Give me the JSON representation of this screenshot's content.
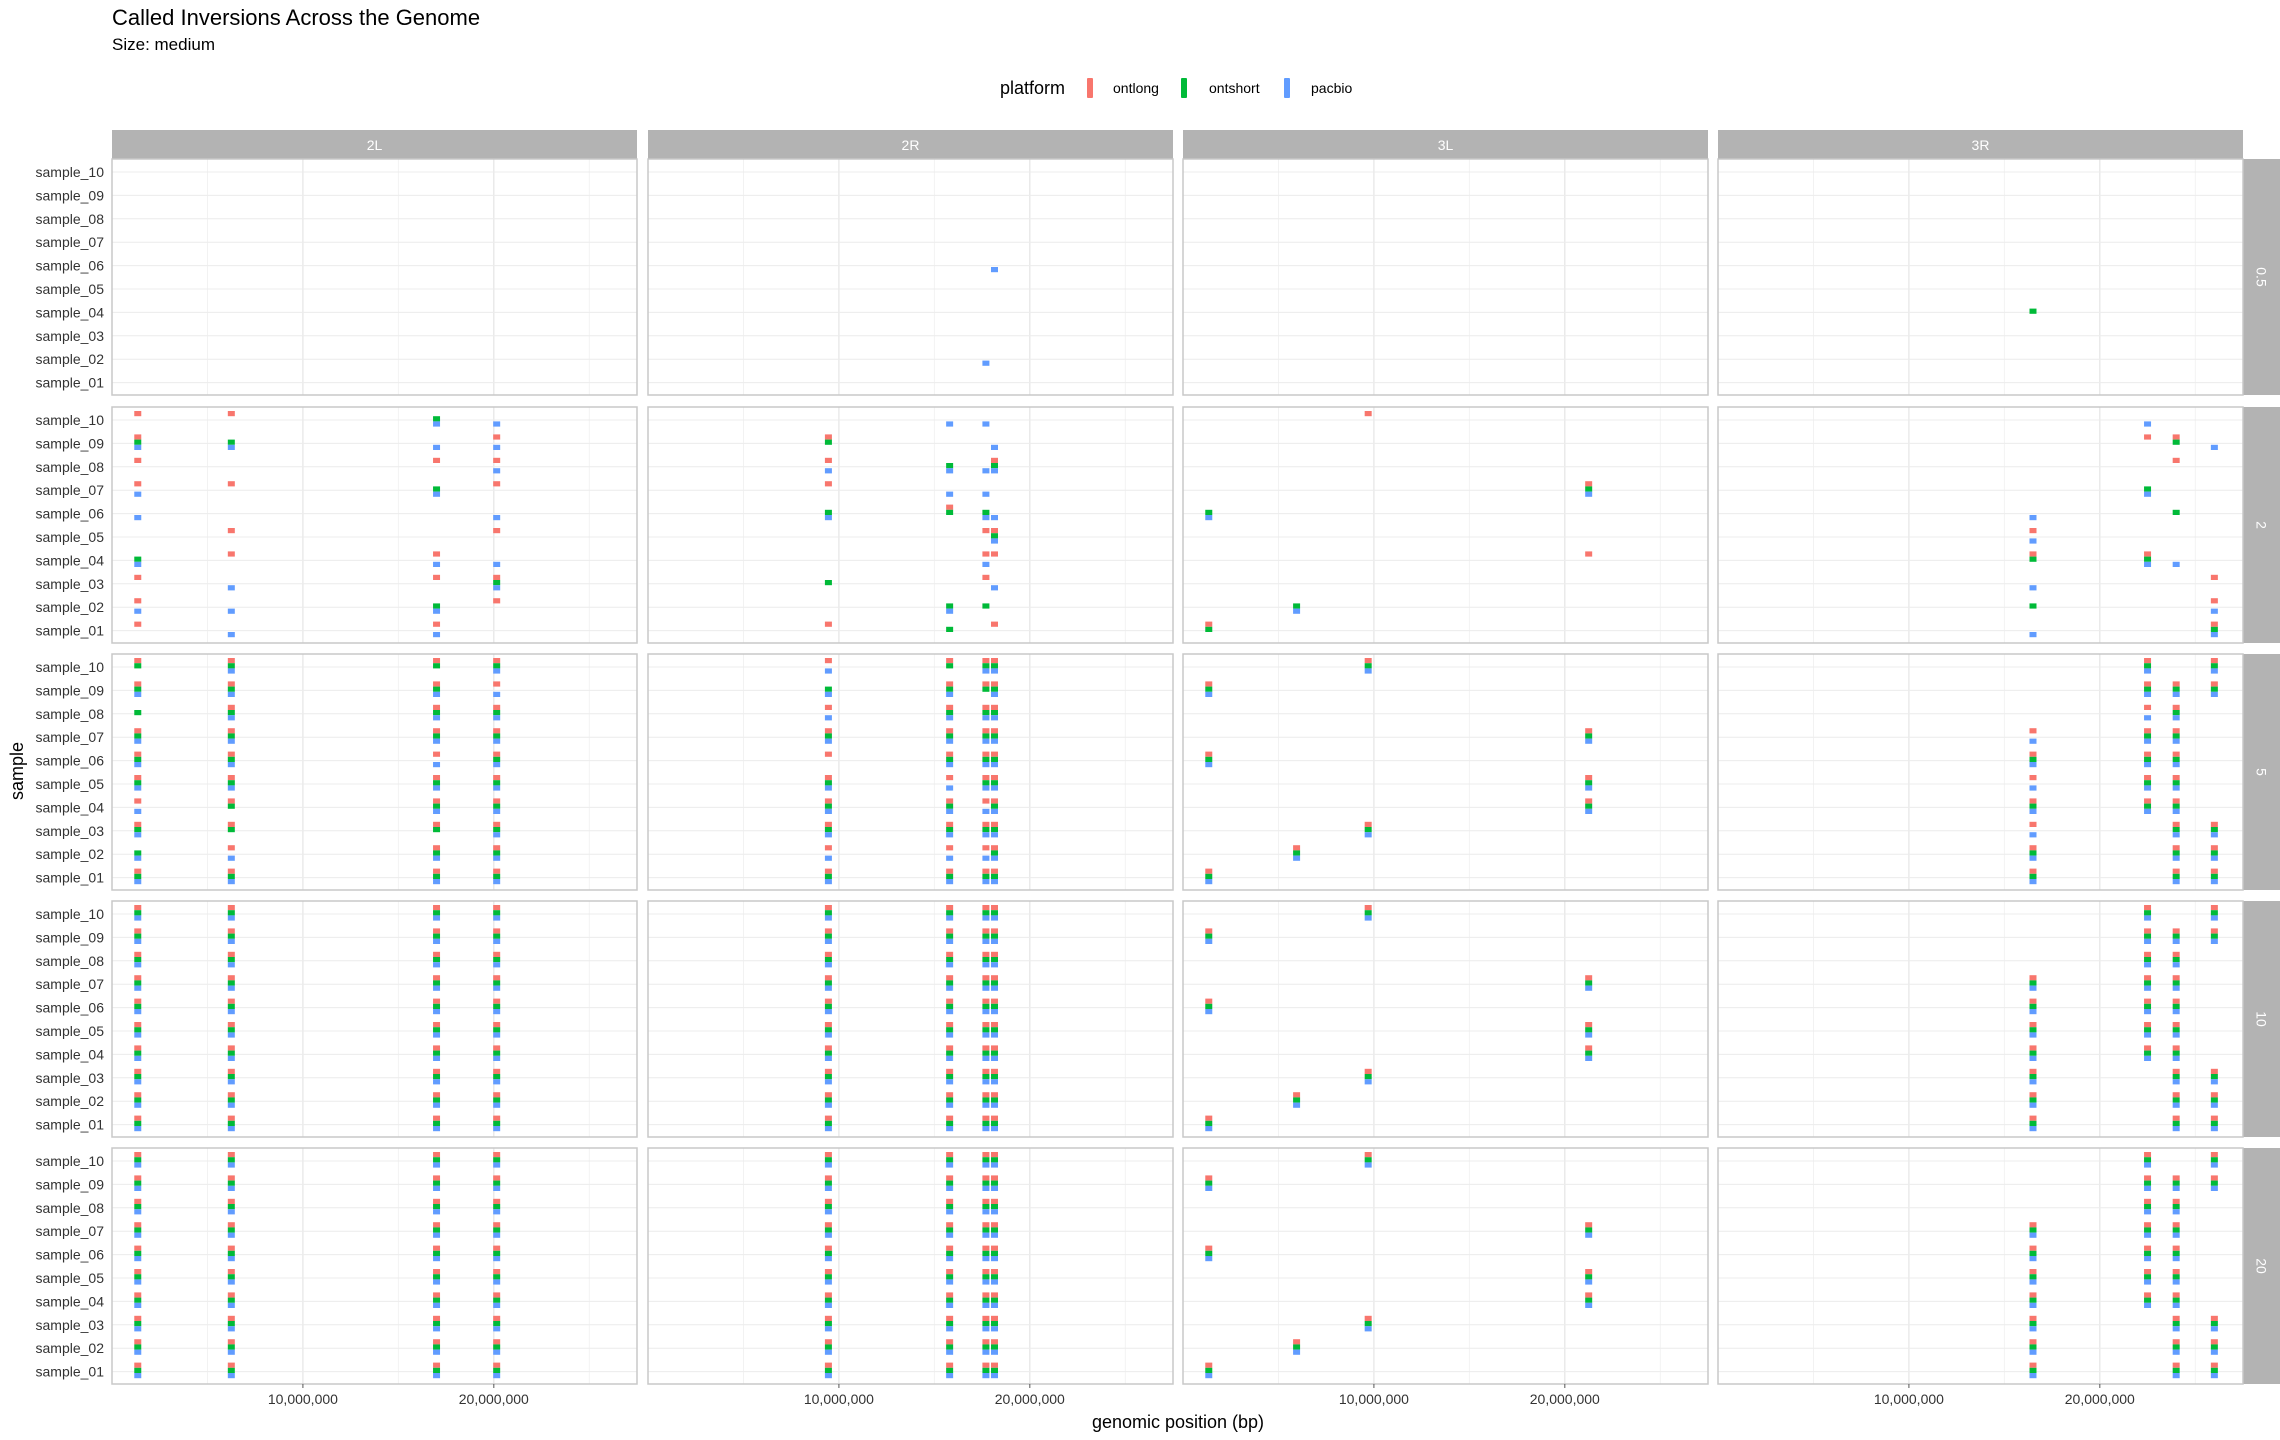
{
  "chart_data": {
    "type": "scatter",
    "title": "Called Inversions Across the Genome",
    "subtitle": "Size: medium",
    "xlabel": "genomic position (bp)",
    "ylabel": "sample",
    "legend": {
      "title": "platform",
      "position": "top",
      "entries": [
        {
          "name": "ontlong",
          "color": "#F8766D"
        },
        {
          "name": "ontshort",
          "color": "#00BA38"
        },
        {
          "name": "pacbio",
          "color": "#619CFF"
        }
      ]
    },
    "samples": [
      "sample_01",
      "sample_02",
      "sample_03",
      "sample_04",
      "sample_05",
      "sample_06",
      "sample_07",
      "sample_08",
      "sample_09",
      "sample_10"
    ],
    "chromosomes": [
      "2L",
      "2R",
      "3L",
      "3R"
    ],
    "coverages": [
      "0.5",
      "2",
      "5",
      "10",
      "20"
    ],
    "xlim": [
      0,
      27500000
    ],
    "x_ticks": [
      {
        "value": 10000000,
        "label": "10,000,000"
      },
      {
        "value": 20000000,
        "label": "20,000,000"
      }
    ],
    "grid": true,
    "inversions": {
      "2L": [
        {
          "pos": 1350000,
          "samples": [
            1,
            2,
            3,
            4,
            5,
            6,
            7,
            8,
            9,
            10
          ]
        },
        {
          "pos": 6250000,
          "samples": [
            1,
            2,
            3,
            4,
            5,
            6,
            7,
            8,
            9,
            10
          ]
        },
        {
          "pos": 17000000,
          "samples": [
            1,
            2,
            3,
            4,
            5,
            6,
            7,
            8,
            9,
            10
          ]
        },
        {
          "pos": 20150000,
          "samples": [
            1,
            2,
            3,
            4,
            5,
            6,
            7,
            8,
            9,
            10
          ]
        }
      ],
      "2R": [
        {
          "pos": 9450000,
          "samples": [
            1,
            2,
            3,
            4,
            5,
            6,
            7,
            8,
            9,
            10
          ]
        },
        {
          "pos": 15800000,
          "samples": [
            1,
            2,
            3,
            4,
            5,
            6,
            7,
            8,
            9,
            10
          ]
        },
        {
          "pos": 17700000,
          "samples": [
            1,
            2,
            3,
            4,
            5,
            6,
            7,
            8,
            9,
            10
          ]
        },
        {
          "pos": 18150000,
          "samples": [
            1,
            2,
            3,
            4,
            5,
            6,
            7,
            8,
            9,
            10
          ]
        }
      ],
      "3L": [
        {
          "pos": 1350000,
          "samples": [
            1,
            6,
            9
          ]
        },
        {
          "pos": 5950000,
          "samples": [
            2
          ]
        },
        {
          "pos": 9700000,
          "samples": [
            3,
            10
          ]
        },
        {
          "pos": 21250000,
          "samples": [
            4,
            5,
            7
          ]
        }
      ],
      "3R": [
        {
          "pos": 16500000,
          "samples": [
            1,
            2,
            3,
            4,
            5,
            6,
            7
          ]
        },
        {
          "pos": 22500000,
          "samples": [
            4,
            5,
            6,
            7,
            8,
            9,
            10
          ]
        },
        {
          "pos": 24000000,
          "samples": [
            1,
            2,
            3,
            4,
            5,
            6,
            7,
            8,
            9
          ]
        },
        {
          "pos": 26000000,
          "samples": [
            1,
            2,
            3,
            9,
            10
          ]
        }
      ]
    }
  }
}
